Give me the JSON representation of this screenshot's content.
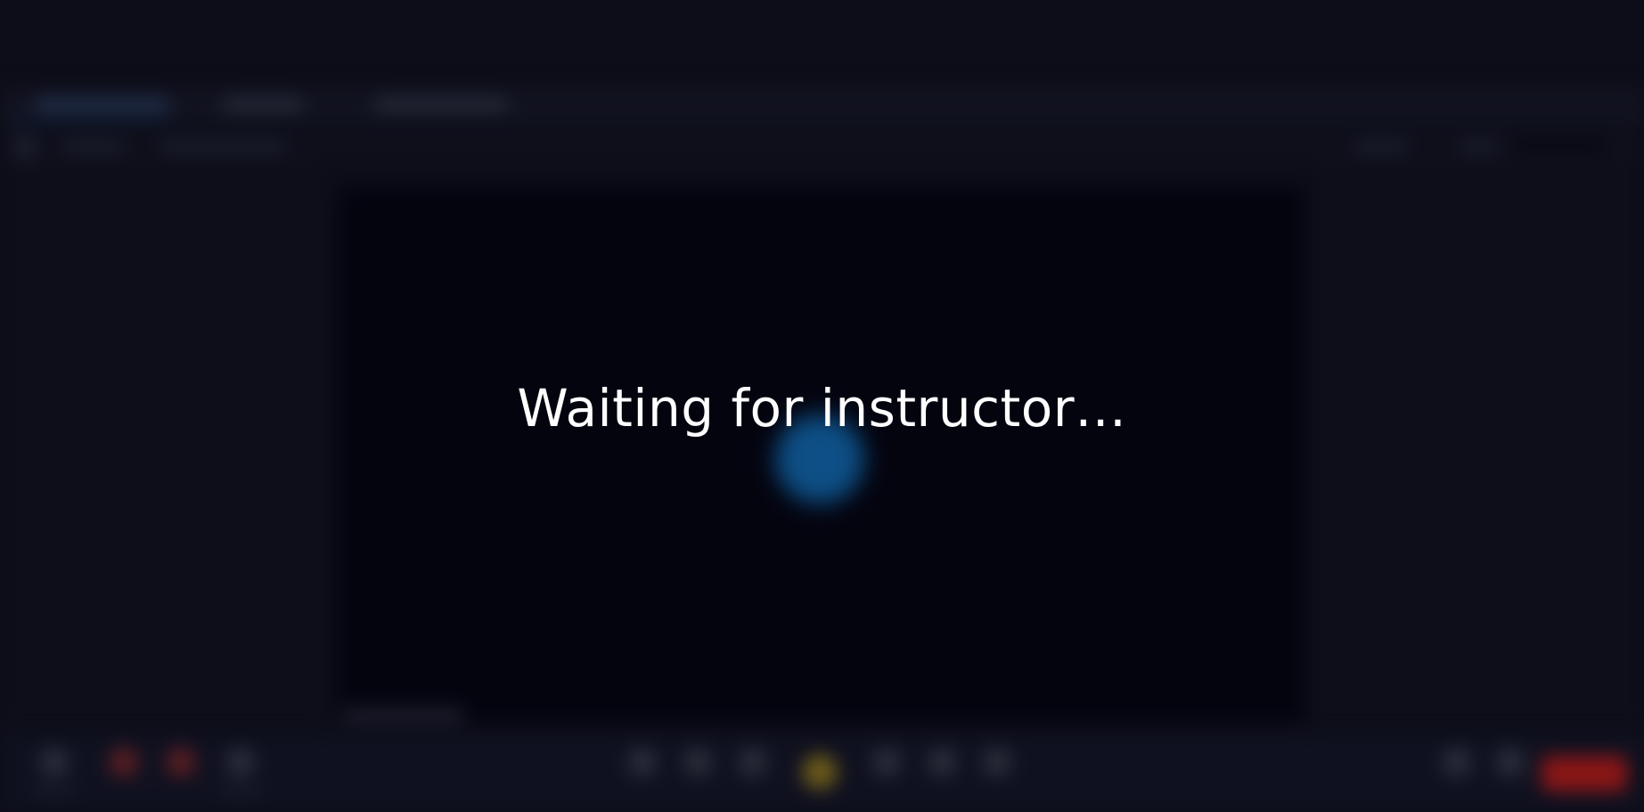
{
  "overlay": {
    "status_text": "Waiting for instructor…"
  },
  "colors": {
    "background": "#0c0d18",
    "video_stage": "#04040f",
    "spinner": "#0d4f86",
    "end_button": "#8a1616",
    "text": "#ffffff"
  },
  "icons": {
    "spinner": "loading-spinner-icon"
  }
}
